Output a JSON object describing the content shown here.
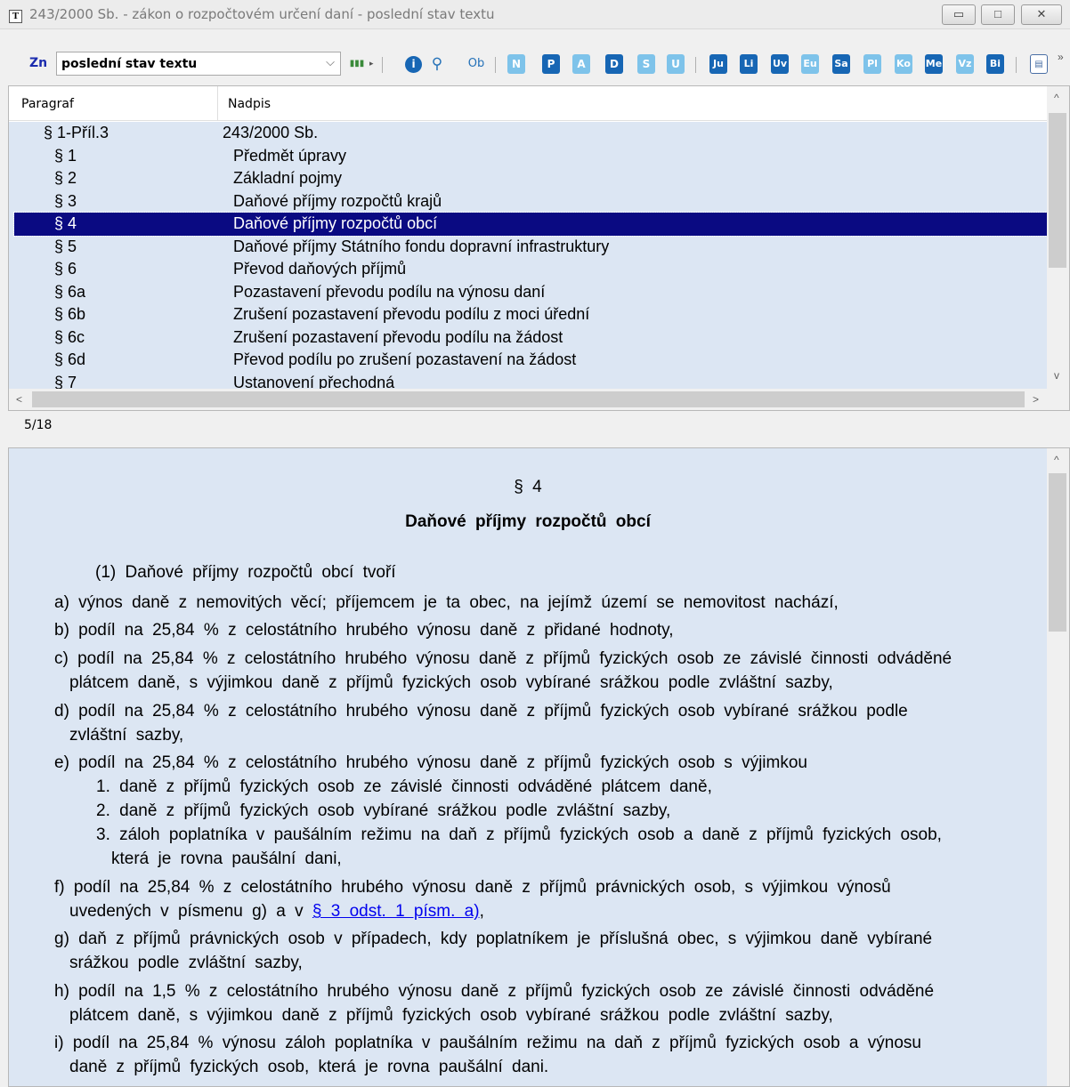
{
  "window": {
    "title": "243/2000 Sb. - zákon o rozpočtovém určení daní - poslední stav textu",
    "app_icon_letter": "T",
    "min_glyph": "▭",
    "max_glyph": "□",
    "close_glyph": "✕"
  },
  "toolbar": {
    "zn_label": "Zn",
    "combo_value": "poslední stav textu",
    "combo_arrow": "⌵",
    "ob_label": "Ob",
    "letter_buttons": [
      "N",
      "P",
      "A",
      "D",
      "S",
      "U"
    ],
    "code_buttons": [
      "Ju",
      "Li",
      "Uv",
      "Eu",
      "Sa",
      "Pl",
      "Ko",
      "Me",
      "Vz",
      "Bi"
    ],
    "more": "»",
    "info_glyph": "i",
    "search_glyph": "⚲",
    "books_glyph": "▮▮▮",
    "doc_glyph": "▤",
    "tri": "▸"
  },
  "grid": {
    "headers": {
      "paragraf": "Paragraf",
      "nadpis": "Nadpis"
    },
    "rows": [
      {
        "paragraf": "§ 1-Příl.3",
        "nadpis": "243/2000 Sb."
      },
      {
        "paragraf": "§ 1",
        "nadpis": "Předmět úpravy"
      },
      {
        "paragraf": "§ 2",
        "nadpis": "Základní pojmy"
      },
      {
        "paragraf": "§ 3",
        "nadpis": "Daňové příjmy rozpočtů krajů"
      },
      {
        "paragraf": "§ 4",
        "nadpis": "Daňové příjmy rozpočtů obcí"
      },
      {
        "paragraf": "§ 5",
        "nadpis": "Daňové příjmy Státního fondu dopravní infrastruktury"
      },
      {
        "paragraf": "§ 6",
        "nadpis": "Převod daňových příjmů"
      },
      {
        "paragraf": "§ 6a",
        "nadpis": "Pozastavení převodu podílu na výnosu daní"
      },
      {
        "paragraf": "§ 6b",
        "nadpis": "Zrušení pozastavení převodu podílu z moci úřední"
      },
      {
        "paragraf": "§ 6c",
        "nadpis": "Zrušení pozastavení převodu podílu na žádost"
      },
      {
        "paragraf": "§ 6d",
        "nadpis": "Převod podílu po zrušení pozastavení na žádost"
      },
      {
        "paragraf": "§ 7",
        "nadpis": "Ustanovení přechodná"
      }
    ],
    "selected_index": 4,
    "scroll_up": "^",
    "scroll_down": "v",
    "scroll_left": "<",
    "scroll_right": ">"
  },
  "status": {
    "position": "5/18"
  },
  "document": {
    "section": "§ 4",
    "title": "Daňové příjmy rozpočtů obcí",
    "intro": "(1) Daňové příjmy rozpočtů obcí tvoří",
    "a": "a) výnos daně z nemovitých věcí; příjemcem je ta obec, na jejímž území se nemovitost nachází,",
    "b": "b) podíl na 25,84 % z celostátního hrubého výnosu daně z přidané hodnoty,",
    "c1": "c) podíl na 25,84 % z celostátního hrubého výnosu daně z příjmů fyzických osob ze závislé činnosti odváděné",
    "c2": "plátcem daně, s výjimkou daně z příjmů fyzických osob vybírané srážkou podle zvláštní sazby,",
    "d1": "d) podíl na 25,84 % z celostátního hrubého výnosu daně z příjmů fyzických osob vybírané srážkou podle",
    "d2": "zvláštní sazby,",
    "e": "e) podíl na 25,84 % z celostátního hrubého výnosu daně z příjmů fyzických osob s výjimkou",
    "e1": "1. daně z příjmů fyzických osob ze závislé činnosti odváděné plátcem daně,",
    "e2": "2. daně z příjmů fyzických osob vybírané srážkou podle zvláštní sazby,",
    "e3a": "3. záloh poplatníka v paušálním režimu na daň z příjmů fyzických osob a daně z příjmů fyzických osob,",
    "e3b": "která je rovna paušální dani,",
    "f1": "f) podíl na 25,84 % z celostátního hrubého výnosu daně z příjmů právnických osob, s výjimkou výnosů",
    "f2_prefix": "uvedených v písmenu g) a v ",
    "f2_link": "§ 3 odst. 1 písm. a)",
    "f2_suffix": ",",
    "g1": "g) daň z příjmů právnických osob v případech, kdy poplatníkem je příslušná obec, s výjimkou daně vybírané",
    "g2": "srážkou podle zvláštní sazby,",
    "h1": "h) podíl na 1,5 % z celostátního hrubého výnosu daně z příjmů fyzických osob ze závislé činnosti odváděné",
    "h2": "plátcem daně, s výjimkou daně z příjmů fyzických osob vybírané srážkou podle zvláštní sazby,",
    "i1": "i) podíl na 25,84 % výnosu záloh poplatníka v paušálním režimu na daň z příjmů fyzických osob a výnosu",
    "i2": "daně z příjmů fyzických osob, která je rovna paušální dani.",
    "scroll_up": "^"
  }
}
